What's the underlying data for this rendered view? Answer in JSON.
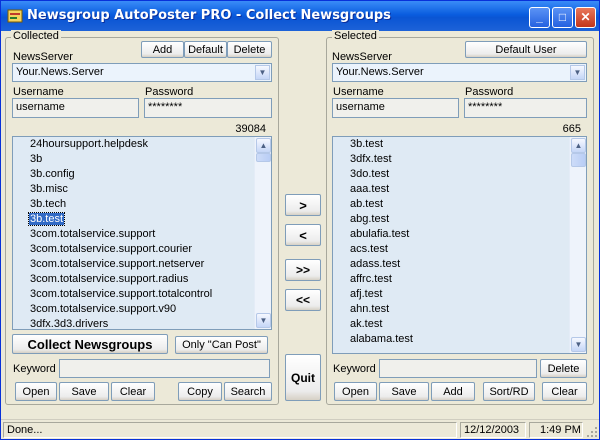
{
  "window": {
    "title": "Newsgroup AutoPoster PRO - Collect Newsgroups",
    "minimize": "_",
    "maximize": "□",
    "close": "✕"
  },
  "colors": {
    "titlebar": "#0a5ddf",
    "selection": "#316ac5",
    "list_bg": "#dfeaf4"
  },
  "collected": {
    "legend": "Collected",
    "newsserver_label": "NewsServer",
    "add_label": "Add",
    "default_label": "Default",
    "delete_label": "Delete",
    "newsserver_value": "Your.News.Server",
    "username_label": "Username",
    "username_value": "username",
    "password_label": "Password",
    "password_value": "********",
    "count": "39084",
    "items": [
      "24hoursupport.helpdesk",
      "3b",
      "3b.config",
      "3b.misc",
      "3b.tech",
      "3b.test",
      "3com.totalservice.support",
      "3com.totalservice.support.courier",
      "3com.totalservice.support.netserver",
      "3com.totalservice.support.radius",
      "3com.totalservice.support.totalcontrol",
      "3com.totalservice.support.v90",
      "3dfx.3d3.drivers"
    ],
    "selected_index": 5,
    "collect_button": "Collect Newsgroups",
    "only_can_post": "Only \"Can Post\"",
    "keyword_label": "Keyword",
    "keyword_value": "",
    "open": "Open",
    "save": "Save",
    "clear": "Clear",
    "copy": "Copy",
    "search": "Search"
  },
  "transfer": {
    "move_right": ">",
    "move_left": "<",
    "move_all_right": ">>",
    "move_all_left": "<<",
    "quit": "Quit"
  },
  "selected": {
    "legend": "Selected",
    "newsserver_label": "NewsServer",
    "default_user_label": "Default User",
    "newsserver_value": "Your.News.Server",
    "username_label": "Username",
    "username_value": "username",
    "password_label": "Password",
    "password_value": "********",
    "count": "665",
    "items": [
      "3b.test",
      "3dfx.test",
      "3do.test",
      "aaa.test",
      "ab.test",
      "abg.test",
      "abulafia.test",
      "acs.test",
      "adass.test",
      "affrc.test",
      "afj.test",
      "ahn.test",
      "ak.test",
      "alabama.test"
    ],
    "keyword_label": "Keyword",
    "keyword_value": "",
    "delete": "Delete",
    "open": "Open",
    "save": "Save",
    "add": "Add",
    "sort_rd": "Sort/RD",
    "clear": "Clear"
  },
  "status": {
    "text": "Done...",
    "date": "12/12/2003",
    "time": "1:49 PM"
  }
}
